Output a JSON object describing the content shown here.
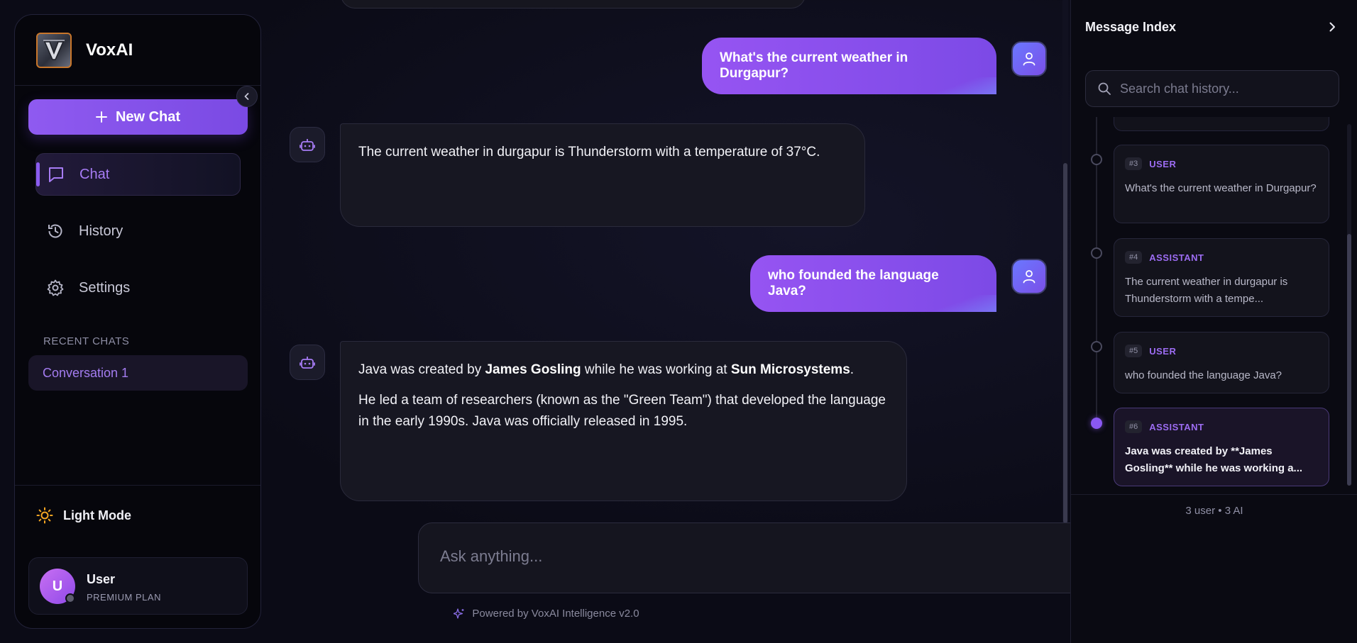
{
  "app": {
    "name": "VoxAI"
  },
  "sidebar": {
    "new_chat_label": "New Chat",
    "nav": [
      {
        "label": "Chat",
        "icon": "chat-bubble-icon",
        "active": true
      },
      {
        "label": "History",
        "icon": "history-icon",
        "active": false
      },
      {
        "label": "Settings",
        "icon": "gear-icon",
        "active": false
      }
    ],
    "recent_title": "RECENT CHATS",
    "recent": [
      {
        "label": "Conversation 1"
      }
    ],
    "theme_toggle_label": "Light Mode",
    "user": {
      "initial": "U",
      "name": "User",
      "plan": "PREMIUM PLAN"
    }
  },
  "chat": {
    "messages": [
      {
        "role": "user",
        "text": "What's the current weather in Durgapur?"
      },
      {
        "role": "assistant",
        "text": "The current weather in durgapur is Thunderstorm with a temperature of 37°C."
      },
      {
        "role": "user",
        "text": "who founded the language Java?"
      },
      {
        "role": "assistant",
        "p1": {
          "a": "Java was created by ",
          "b1": "James Gosling",
          "c": " while he was working at ",
          "b2": "Sun Microsystems",
          "d": "."
        },
        "p2": "He led a team of researchers (known as the \"Green Team\") that developed the language in the early 1990s. Java was officially released in 1995."
      }
    ],
    "composer_placeholder": "Ask anything...",
    "powered_by": "Powered by VoxAI Intelligence v2.0"
  },
  "index_panel": {
    "title": "Message Index",
    "search_placeholder": "Search chat history...",
    "items": [
      {
        "num": "#3",
        "role": "USER",
        "preview": "What's the current weather in Durgapur?"
      },
      {
        "num": "#4",
        "role": "ASSISTANT",
        "preview": "The current weather in durgapur is Thunderstorm with a tempe..."
      },
      {
        "num": "#5",
        "role": "USER",
        "preview": "who founded the language Java?"
      },
      {
        "num": "#6",
        "role": "ASSISTANT",
        "preview": "Java was created by **James Gosling** while he was working a..."
      }
    ],
    "footer": "3 user • 3 AI"
  },
  "colors": {
    "accent": "#8a58f2",
    "background": "#0b0b16",
    "panel": "#06060c"
  }
}
